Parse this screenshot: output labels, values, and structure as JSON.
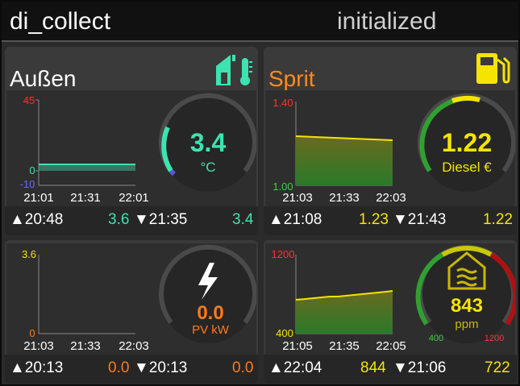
{
  "header": {
    "title": "di_collect",
    "status": "initialized"
  },
  "cards": {
    "aussen": {
      "title": "Außen",
      "icon": "house-thermometer-icon",
      "chart": {
        "ymax": "45",
        "y0": "0",
        "ymin": "-10",
        "x": [
          "21:01",
          "21:31",
          "22:01"
        ]
      },
      "gauge": {
        "value": "3.4",
        "unit": "°C",
        "fraction": 0.2
      },
      "footer": {
        "max_time": "▲20:48",
        "max_val": "3.6",
        "min_time": "▼21:35",
        "min_val": "3.4"
      },
      "colors": {
        "accent": "#3de3b0",
        "title": "#ffffff"
      }
    },
    "sprit": {
      "title": "Sprit",
      "icon": "fuel-pump-icon",
      "chart": {
        "ymax": "1.40",
        "ymin": "1.00",
        "x": [
          "21:03",
          "21:33",
          "22:03"
        ]
      },
      "gauge": {
        "value": "1.22",
        "unit": "Diesel €",
        "fraction": 0.55
      },
      "footer": {
        "max_time": "▲21:08",
        "max_val": "1.23",
        "min_time": "▼21:43",
        "min_val": "1.22"
      },
      "colors": {
        "accent": "#f5e400",
        "title": "#ff8a1e"
      }
    },
    "pv": {
      "title": "",
      "icon": "lightning-icon",
      "chart": {
        "ymax": "3.6",
        "ymin": "0",
        "x": [
          "21:03",
          "21:33",
          "22:03"
        ]
      },
      "gauge": {
        "value": "0.0",
        "unit": "PV kW",
        "fraction": 0
      },
      "footer": {
        "max_time": "▲20:13",
        "max_val": "0.0",
        "min_time": "▼20:13",
        "min_val": "0.0"
      },
      "colors": {
        "accent": "#ff7a1a"
      }
    },
    "co2": {
      "title": "",
      "icon": "house-air-icon",
      "chart": {
        "ymax": "1200",
        "ymin": "400",
        "x": [
          "21:05",
          "21:35",
          "22:05"
        ]
      },
      "gauge": {
        "value": "843",
        "unit": "ppm",
        "scale_min": "400",
        "scale_max": "1200",
        "fraction": 0.55
      },
      "footer": {
        "max_time": "▲22:04",
        "max_val": "844",
        "min_time": "▼21:06",
        "min_val": "722"
      },
      "colors": {
        "accent": "#f5e400"
      }
    }
  }
}
